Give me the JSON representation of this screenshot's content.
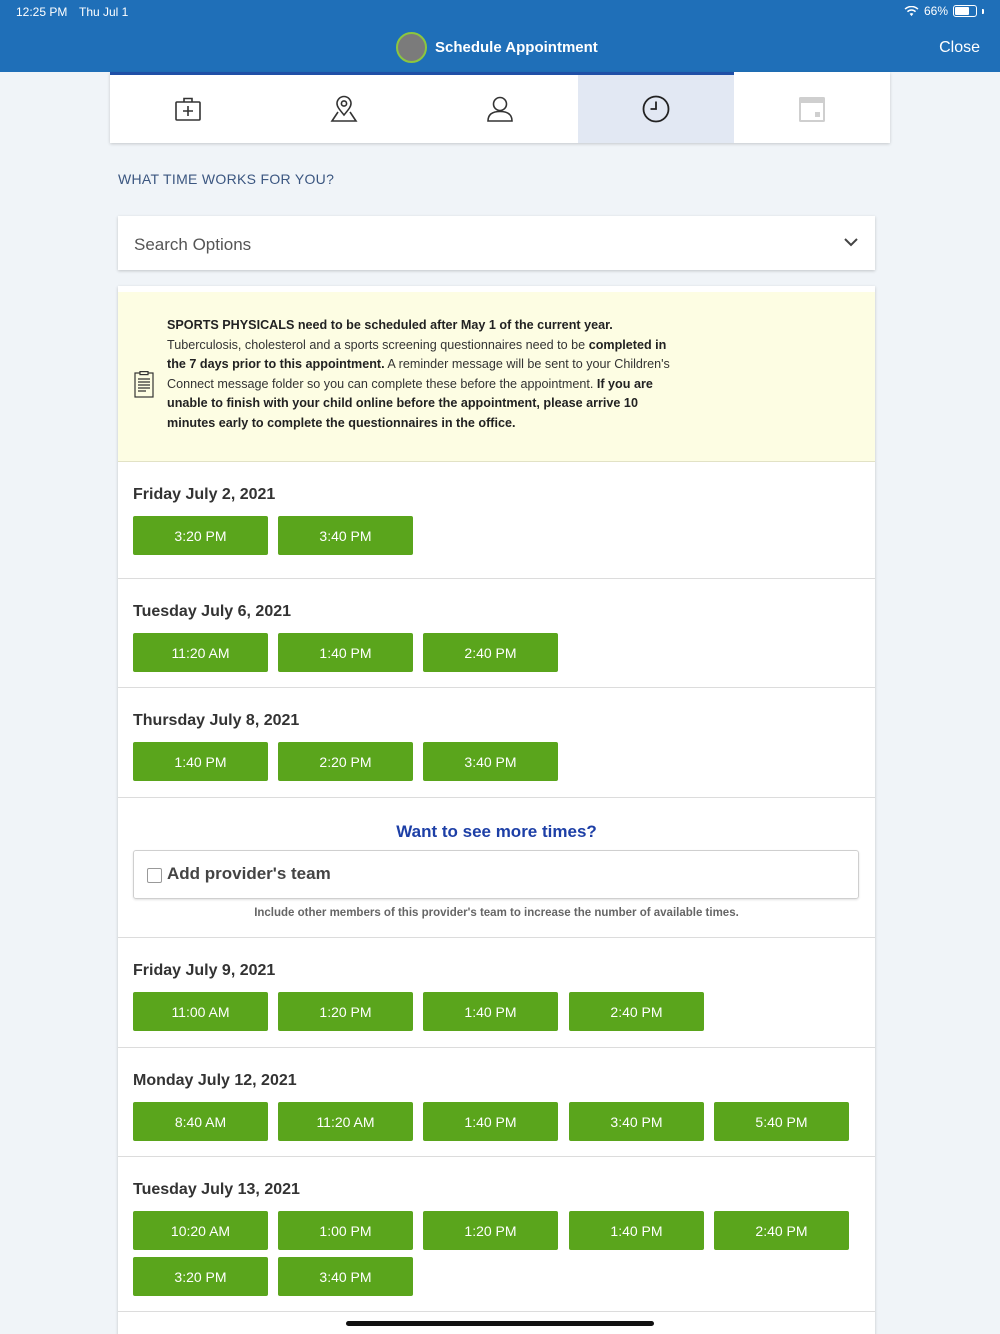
{
  "status_bar": {
    "time": "12:25 PM",
    "date": "Thu Jul 1",
    "battery": "66%",
    "battery_level": 0.66
  },
  "nav": {
    "title": "Schedule Appointment",
    "close_label": "Close"
  },
  "tabs": [
    {
      "icon": "medical-bag-icon",
      "state": "done"
    },
    {
      "icon": "map-pin-icon",
      "state": "done"
    },
    {
      "icon": "person-icon",
      "state": "done"
    },
    {
      "icon": "clock-icon",
      "state": "active"
    },
    {
      "icon": "calendar-icon",
      "state": "upcoming"
    }
  ],
  "heading": "WHAT TIME WORKS FOR YOU?",
  "search": {
    "label": "Search Options"
  },
  "notice": {
    "b1": "SPORTS PHYSICALS need to be scheduled after May 1 of the current year.",
    "t1": " Tuberculosis, cholesterol and a sports screening questionnaires need to be ",
    "b2": "completed in the 7 days prior to this appointment.",
    "t2": " A reminder message will be sent to your Children's Connect message folder so you can complete these before the appointment. ",
    "b3": "If you are unable to finish with your child online before the appointment, please arrive 10 minutes early to complete the questionnaires in the office."
  },
  "days": [
    {
      "label": "Friday July 2, 2021",
      "times": [
        "3:20 PM",
        "3:40 PM"
      ]
    },
    {
      "label": "Tuesday July 6, 2021",
      "times": [
        "11:20 AM",
        "1:40 PM",
        "2:40 PM"
      ]
    },
    {
      "label": "Thursday July 8, 2021",
      "times": [
        "1:40 PM",
        "2:20 PM",
        "3:40 PM"
      ]
    },
    {
      "label": "Friday July 9, 2021",
      "times": [
        "11:00 AM",
        "1:20 PM",
        "1:40 PM",
        "2:40 PM"
      ]
    },
    {
      "label": "Monday July 12, 2021",
      "times": [
        "8:40 AM",
        "11:20 AM",
        "1:40 PM",
        "3:40 PM",
        "5:40 PM"
      ]
    },
    {
      "label": "Tuesday July 13, 2021",
      "times": [
        "10:20 AM",
        "1:00 PM",
        "1:20 PM",
        "1:40 PM",
        "2:40 PM",
        "3:20 PM",
        "3:40 PM"
      ]
    }
  ],
  "more": {
    "title": "Want to see more times?",
    "checkbox_label": "Add provider's team",
    "checked": false,
    "help": "Include other members of this provider's team to increase the number of available times."
  },
  "colors": {
    "header": "#1f6fb8",
    "slot": "#5aa51c",
    "link": "#1d3fa6",
    "notice_bg": "#fdfde3"
  }
}
